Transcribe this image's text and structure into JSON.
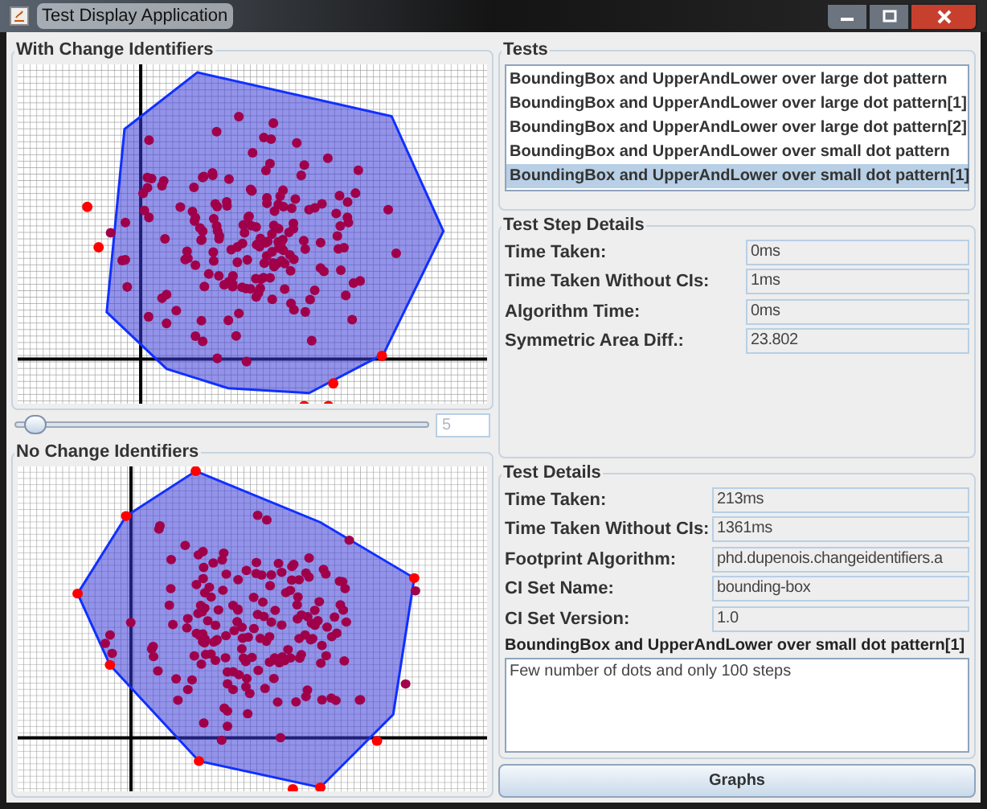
{
  "window": {
    "title": "Test Display Application"
  },
  "top_plot": {
    "title": "With Change Identifiers"
  },
  "step_slider": {
    "level": 0.05,
    "reading": "5"
  },
  "bottom_plot": {
    "title": "No Change Identifiers"
  },
  "tests": {
    "title": "Tests",
    "items": [
      {
        "label": "BoundingBox and UpperAndLower over large dot pattern",
        "selected": false
      },
      {
        "label": "BoundingBox and UpperAndLower over large dot pattern[1]",
        "selected": false
      },
      {
        "label": "BoundingBox and UpperAndLower over large dot pattern[2]",
        "selected": false
      },
      {
        "label": "BoundingBox and UpperAndLower over small dot pattern",
        "selected": false
      },
      {
        "label": "BoundingBox and UpperAndLower over small dot pattern[1]",
        "selected": true
      }
    ]
  },
  "test_step_details": {
    "title": "Test Step Details",
    "fields": [
      {
        "label": "Time Taken:",
        "value": "0ms"
      },
      {
        "label": "Time Taken Without CIs:",
        "value": "1ms"
      },
      {
        "label": "Algorithm Time:",
        "value": "0ms"
      },
      {
        "label": "Symmetric Area Diff.:",
        "value": "23.802"
      }
    ]
  },
  "test_details": {
    "title": "Test Details",
    "fields": [
      {
        "label": "Time Taken:",
        "value": "213ms"
      },
      {
        "label": "Time Taken Without CIs:",
        "value": "1361ms"
      },
      {
        "label": "Footprint Algorithm:",
        "value": "phd.dupenois.changeidentifiers.a"
      },
      {
        "label": "CI Set Name:",
        "value": "bounding-box"
      },
      {
        "label": "CI Set Version:",
        "value": "1.0"
      }
    ],
    "test_name": "BoundingBox and UpperAndLower over small dot pattern[1]",
    "description": "Few number of dots and only 100 steps"
  },
  "buttons": [
    {
      "label": "Graphs"
    }
  ]
}
